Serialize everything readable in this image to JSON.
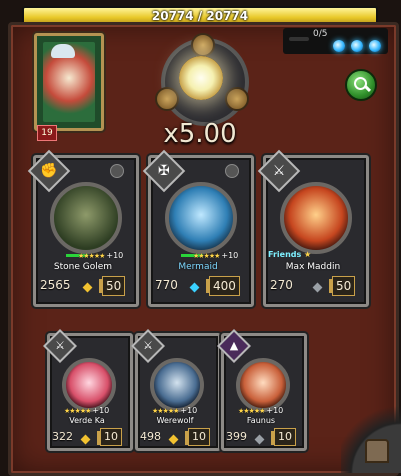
{
  "hp": {
    "current": 20774,
    "max": 20774,
    "text": "20774 / 20774",
    "fill_fraction": 1.0
  },
  "orbs": {
    "count_text": "0/5",
    "orb_count": 3,
    "color": "#35b7ff"
  },
  "card": {
    "icon": "santa-card-icon",
    "level": "19"
  },
  "multiplier": "x5.00",
  "search_icon": "search-icon",
  "heroes_top": [
    {
      "name": "Stone Golem",
      "stars": "★★★★★",
      "plus": "+10",
      "hp": "2565",
      "cost": "50",
      "gem_color": "#f2c230",
      "class_icon": "fist-icon",
      "bar": true
    },
    {
      "name": "Mermaid",
      "stars": "★★★★★",
      "plus": "+10",
      "hp": "770",
      "cost": "400",
      "gem_color": "#3ad1ff",
      "class_icon": "wings-icon",
      "bar": true
    },
    {
      "name": "Max Maddin",
      "stars": "★",
      "plus": "",
      "hp": "270",
      "cost": "50",
      "gem_color": "#9aa0a6",
      "class_icon": "sword-icon",
      "friends": "Friends",
      "bar": false
    }
  ],
  "heroes_bottom": [
    {
      "name": "Verde Ka",
      "stars": "★★★★★",
      "plus": "+10",
      "hp": "322",
      "cost": "10",
      "gem_color": "#f2c230",
      "class_icon": "sword-icon"
    },
    {
      "name": "Werewolf",
      "stars": "★★★★★",
      "plus": "+10",
      "hp": "498",
      "cost": "10",
      "gem_color": "#f2c230",
      "class_icon": "sword-icon"
    },
    {
      "name": "Faunus",
      "stars": "★★★★★",
      "plus": "+10",
      "hp": "399",
      "cost": "10",
      "gem_color": "#9aa0a6",
      "class_icon": "witch-hat-icon"
    }
  ],
  "exit_icon": "door-icon"
}
